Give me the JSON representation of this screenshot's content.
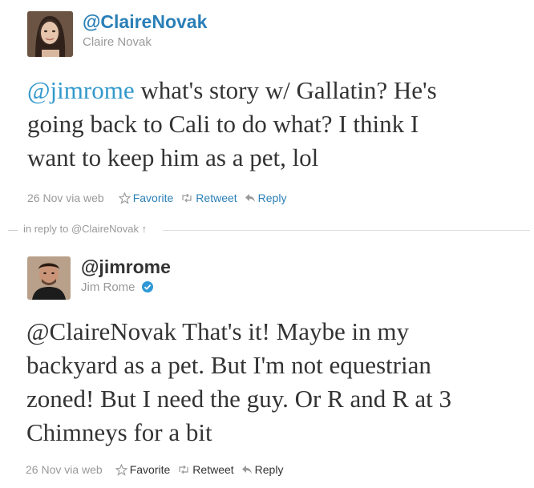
{
  "tweet1": {
    "handle": "@ClaireNovak",
    "name": "Claire Novak",
    "mention": "@jimrome",
    "text_line1": " what's story w/ Gallatin? He's",
    "text_line2": "going back to Cali to do what? I think I",
    "text_line3": "want to keep him as a pet, lol",
    "date": "26 Nov",
    "via": "via web",
    "favorite": "Favorite",
    "retweet": "Retweet",
    "reply": "Reply"
  },
  "reply_context": {
    "label": "in reply to @ClaireNovak ↑"
  },
  "tweet2": {
    "handle": "@jimrome",
    "name": "Jim Rome",
    "verified": true,
    "text_line1": "@ClaireNovak That's it! Maybe in my",
    "text_line2": "backyard as a pet. But I'm not equestrian",
    "text_line3": "zoned! But I need the guy. Or R and R at 3",
    "text_line4": "Chimneys for a bit",
    "date": "26 Nov",
    "via": "via web",
    "favorite": "Favorite",
    "retweet": "Retweet",
    "reply": "Reply"
  },
  "colors": {
    "link": "#2a7fb7",
    "mention": "#3399cc",
    "muted": "#999999",
    "text": "#333333"
  }
}
